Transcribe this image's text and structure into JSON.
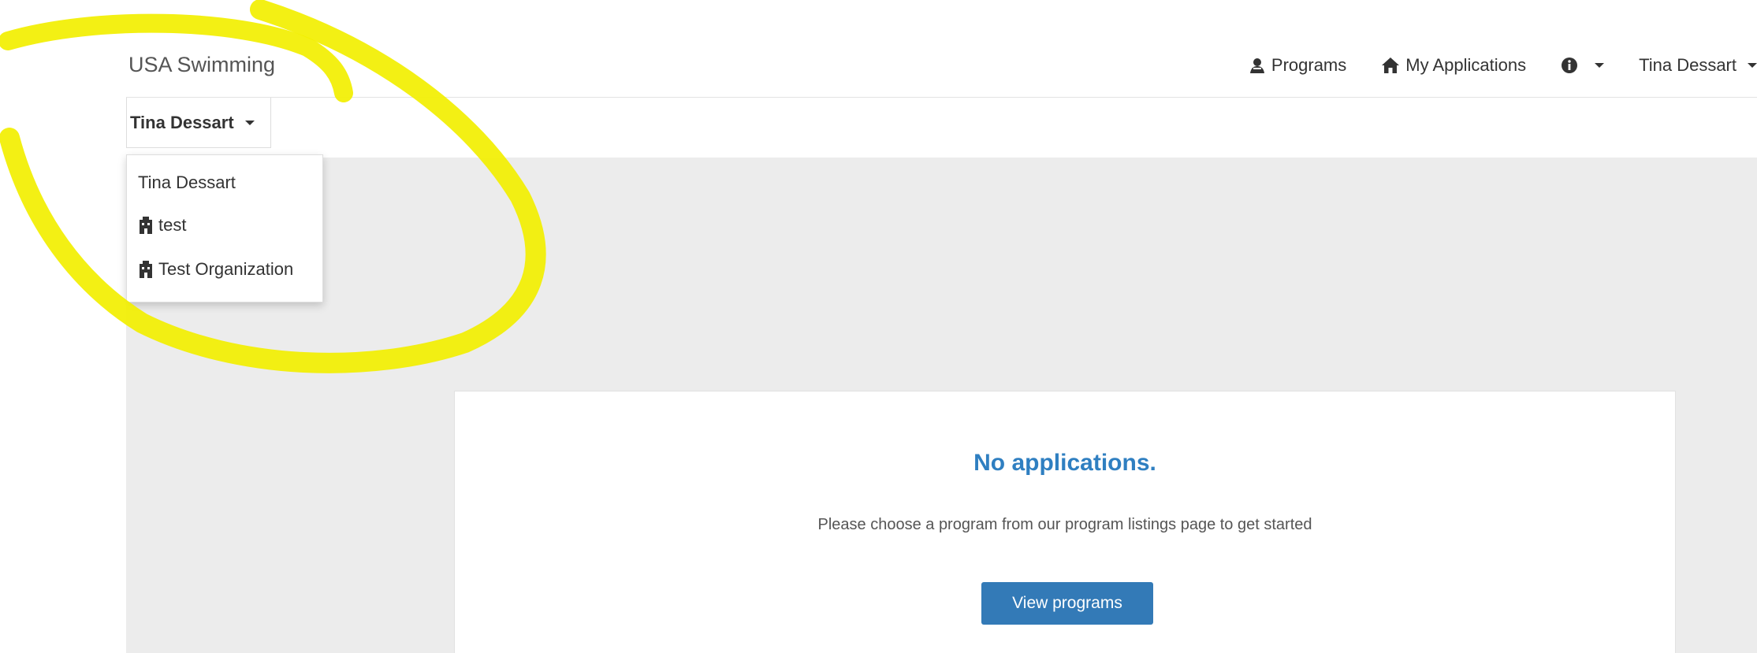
{
  "navbar": {
    "brand": "USA Swimming",
    "items": [
      {
        "label": "Programs",
        "icon": "programs-icon"
      },
      {
        "label": "My Applications",
        "icon": "home-icon"
      },
      {
        "label": "",
        "icon": "info-icon"
      },
      {
        "label": "Tina Dessart",
        "icon": ""
      }
    ]
  },
  "context_switcher": {
    "label": "Tina Dessart",
    "options": [
      {
        "label": "Tina Dessart",
        "icon": ""
      },
      {
        "label": "test",
        "icon": "organization-icon"
      },
      {
        "label": "Test Organization",
        "icon": "organization-icon"
      }
    ]
  },
  "empty_state": {
    "title": "No applications.",
    "message": "Please choose a program from our program listings page to get started",
    "button_label": "View programs"
  },
  "colors": {
    "accent": "#337ab7",
    "title": "#2f7fc1",
    "content_bg": "#ececec",
    "annotation": "#f2ef00"
  }
}
